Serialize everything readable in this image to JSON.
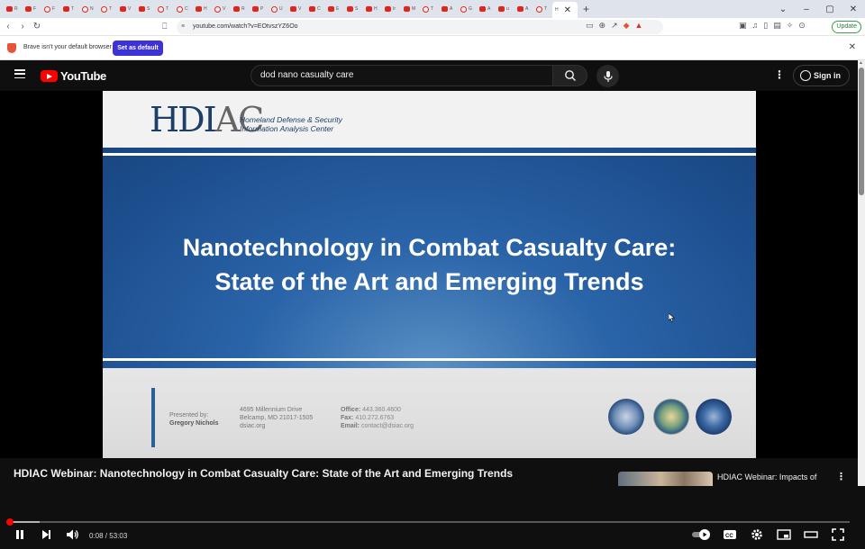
{
  "browser": {
    "tabs": [
      {
        "label": "R",
        "fav": "yt"
      },
      {
        "label": "F",
        "fav": "yt"
      },
      {
        "label": "F",
        "fav": "o"
      },
      {
        "label": "T",
        "fav": "yt"
      },
      {
        "label": "N",
        "fav": "o"
      },
      {
        "label": "T",
        "fav": "o"
      },
      {
        "label": "V",
        "fav": "yt"
      },
      {
        "label": "S",
        "fav": "yt"
      },
      {
        "label": "T",
        "fav": "o"
      },
      {
        "label": "C",
        "fav": "o"
      },
      {
        "label": "H",
        "fav": "yt"
      },
      {
        "label": "V",
        "fav": "o"
      },
      {
        "label": "R",
        "fav": "yt"
      },
      {
        "label": "P",
        "fav": "yt"
      },
      {
        "label": "U",
        "fav": "o"
      },
      {
        "label": "V",
        "fav": "yt"
      },
      {
        "label": "C",
        "fav": "yt"
      },
      {
        "label": "E",
        "fav": "yt"
      },
      {
        "label": "S",
        "fav": "yt"
      },
      {
        "label": "H",
        "fav": "yt"
      },
      {
        "label": "Ir",
        "fav": "yt"
      },
      {
        "label": "M",
        "fav": "yt"
      },
      {
        "label": "T",
        "fav": "o"
      },
      {
        "label": "A",
        "fav": "yt"
      },
      {
        "label": "G",
        "fav": "o"
      },
      {
        "label": "A",
        "fav": "yt"
      },
      {
        "label": "u",
        "fav": "yt"
      },
      {
        "label": "A",
        "fav": "yt"
      },
      {
        "label": "T",
        "fav": "o"
      }
    ],
    "active_tab_label": "H",
    "url": "youtube.com/watch?v=EOtvszYZ6Oo",
    "update_label": "Update",
    "default_browser_message": "Brave isn't your default browser",
    "set_default_label": "Set as default"
  },
  "youtube": {
    "logo_text": "YouTube",
    "search_query": "dod nano casualty care",
    "sign_in_label": "Sign in"
  },
  "slide": {
    "logo_main": "HDI",
    "logo_tail": "AC",
    "logo_subtitle_1": "Homeland Defense & Security",
    "logo_subtitle_2": "Information Analysis Center",
    "title_line_1": "Nanotechnology in Combat Casualty Care:",
    "title_line_2": "State of the Art and Emerging Trends",
    "presented_by": "Presented by:",
    "presenter": "Gregory Nichols",
    "address_1": "4695 Millennium Drive",
    "address_2": "Belcamp, MD 21017-1505",
    "address_3": "dsiac.org",
    "office_label": "Office:",
    "office": "443.360.4600",
    "fax_label": "Fax:",
    "fax": "410.272.6763",
    "email_label": "Email:",
    "email": "contact@dsiac.org"
  },
  "player": {
    "current_time": "0:08",
    "duration": "53:03",
    "progress_fraction": 0.0025
  },
  "video": {
    "title": "HDIAC Webinar: Nanotechnology in Combat Casualty Care: State of the Art and Emerging Trends"
  },
  "recommendation": {
    "title": "HDIAC Webinar: Impacts of"
  }
}
